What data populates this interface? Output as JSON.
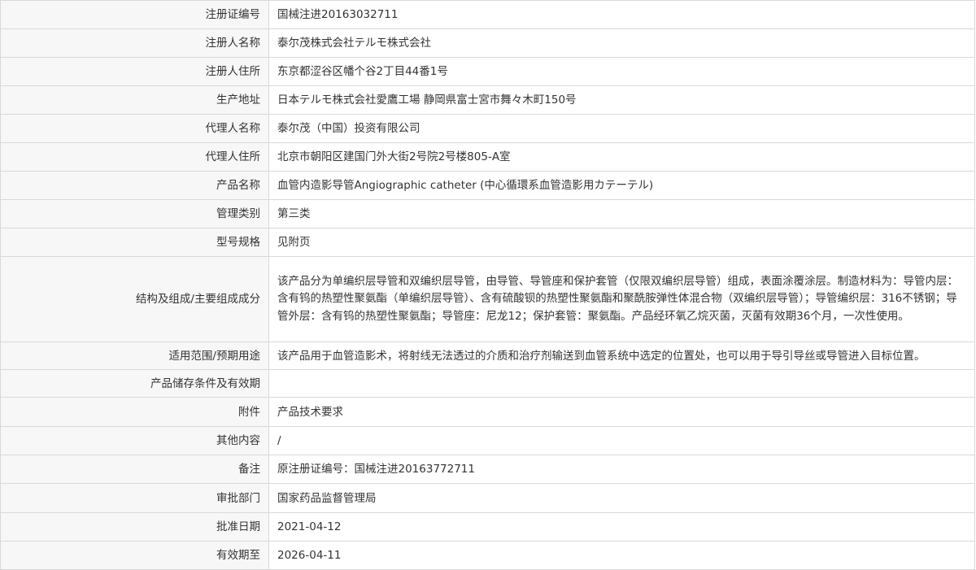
{
  "rows": [
    {
      "label": "注册证编号",
      "value": "国械注进20163032711"
    },
    {
      "label": "注册人名称",
      "value": "泰尔茂株式会社テルモ株式会社"
    },
    {
      "label": "注册人住所",
      "value": "东京都涩谷区幡个谷2丁目44番1号"
    },
    {
      "label": "生产地址",
      "value": "日本テルモ株式会社愛鷹工場 静岡県富士宮市舞々木町150号"
    },
    {
      "label": "代理人名称",
      "value": "泰尔茂（中国）投资有限公司"
    },
    {
      "label": "代理人住所",
      "value": "北京市朝阳区建国门外大街2号院2号楼805-A室"
    },
    {
      "label": "产品名称",
      "value": "血管内造影导管Angiographic catheter (中心循環系血管造影用カテーテル)"
    },
    {
      "label": "管理类别",
      "value": "第三类"
    },
    {
      "label": "型号规格",
      "value": "见附页"
    },
    {
      "label": "结构及组成/主要组成成分",
      "value": "该产品分为单编织层导管和双编织层导管，由导管、导管座和保护套管（仅限双编织层导管）组成，表面涂覆涂层。制造材料为：导管内层：含有钨的热塑性聚氨酯（单编织层导管）、含有硫酸钡的热塑性聚氨酯和聚酰胺弹性体混合物（双编织层导管）；导管编织层：316不锈钢；导管外层：含有钨的热塑性聚氨酯；导管座：尼龙12；保护套管：聚氨酯。产品经环氧乙烷灭菌，灭菌有效期36个月，一次性使用。"
    },
    {
      "label": "适用范围/预期用途",
      "value": "该产品用于血管造影术，将射线无法透过的介质和治疗剂输送到血管系统中选定的位置处，也可以用于导引导丝或导管进入目标位置。"
    },
    {
      "label": "产品储存条件及有效期",
      "value": ""
    },
    {
      "label": "附件",
      "value": "产品技术要求"
    },
    {
      "label": "其他内容",
      "value": "/"
    },
    {
      "label": "备注",
      "value": "原注册证编号：国械注进20163772711"
    },
    {
      "label": "审批部门",
      "value": "国家药品监督管理局"
    },
    {
      "label": "批准日期",
      "value": "2021-04-12"
    },
    {
      "label": "有效期至",
      "value": "2026-04-11"
    }
  ]
}
